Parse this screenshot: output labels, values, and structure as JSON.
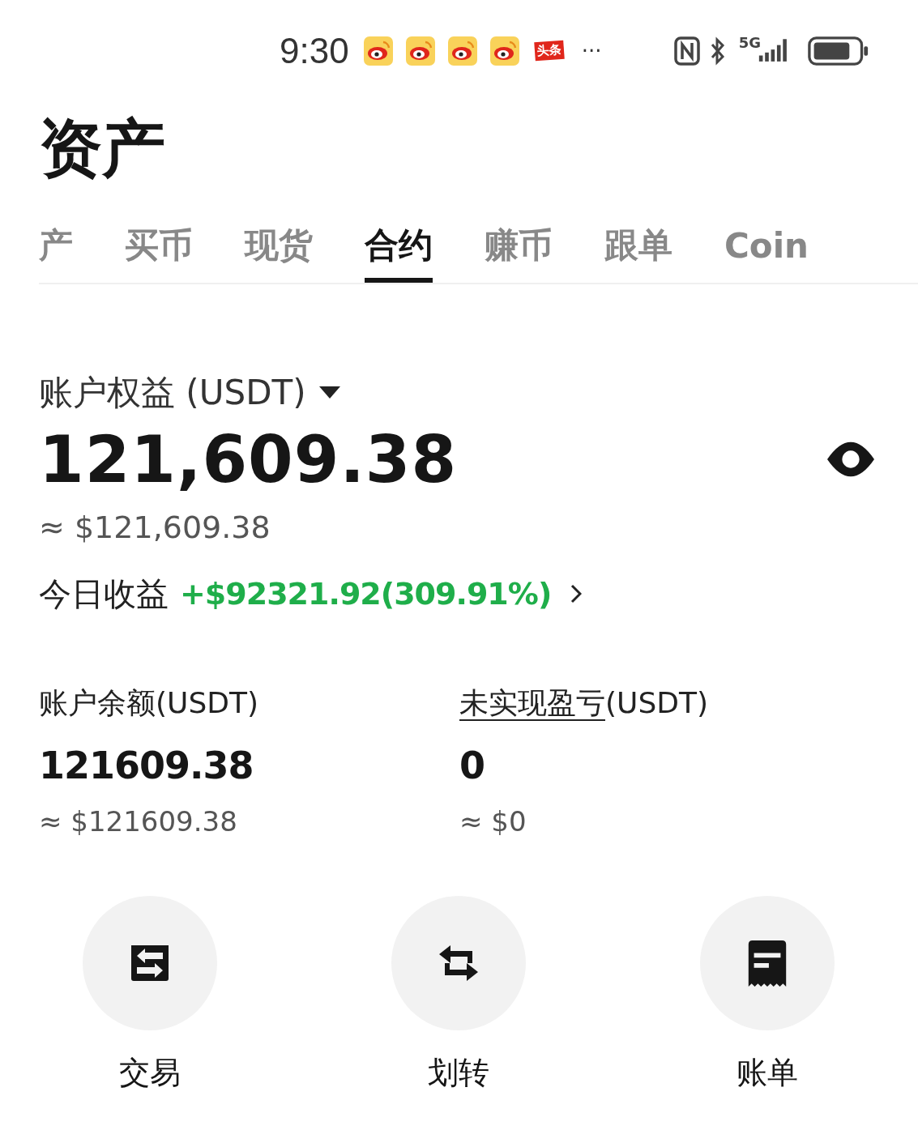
{
  "status_bar": {
    "time": "9:30",
    "notifications": [
      {
        "kind": "weibo"
      },
      {
        "kind": "weibo"
      },
      {
        "kind": "weibo"
      },
      {
        "kind": "weibo"
      },
      {
        "kind": "toutiao",
        "label": "头条"
      }
    ],
    "more": "···",
    "network": "5G"
  },
  "title": "资产",
  "tabs": [
    {
      "label": "产",
      "selected": false
    },
    {
      "label": "买币",
      "selected": false
    },
    {
      "label": "现货",
      "selected": false
    },
    {
      "label": "合约",
      "selected": true
    },
    {
      "label": "赚币",
      "selected": false
    },
    {
      "label": "跟单",
      "selected": false
    },
    {
      "label": "Coin",
      "selected": false
    }
  ],
  "equity": {
    "label": "账户权益 (USDT)",
    "amount": "121,609.38",
    "approx": "≈ $121,609.38",
    "today_label": "今日收益",
    "today_value": "+$92321.92(309.91%)"
  },
  "balances": [
    {
      "label": "账户余额(USDT)",
      "underlined": false,
      "value": "121609.38",
      "approx": "≈ $121609.38"
    },
    {
      "label": "未实现盈亏",
      "label_suffix": "(USDT)",
      "underlined": true,
      "value": "0",
      "approx": "≈ $0"
    }
  ],
  "actions": [
    {
      "kind": "trade",
      "label": "交易"
    },
    {
      "kind": "transfer",
      "label": "划转"
    },
    {
      "kind": "bill",
      "label": "账单"
    }
  ]
}
